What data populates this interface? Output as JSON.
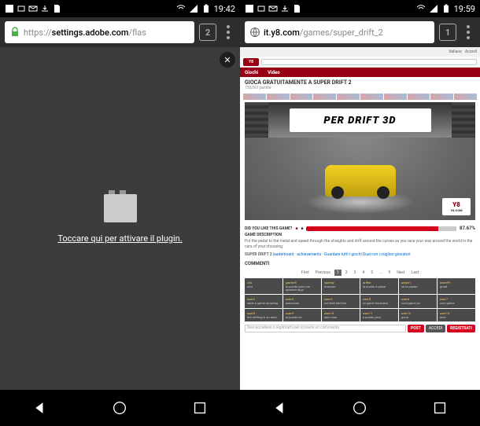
{
  "left": {
    "status": {
      "time": "19:42"
    },
    "browser": {
      "url_protocol": "https://",
      "url_domain": "settings.adobe.com",
      "url_path": "/flas",
      "tab_count": "2"
    },
    "content": {
      "plugin_text": "Toccare qui per attivare il plugin."
    }
  },
  "right": {
    "status": {
      "time": "19:59"
    },
    "browser": {
      "url_domain": "it.y8.com",
      "url_path": "/games/super_drift_2",
      "tab_count": "1"
    },
    "y8": {
      "logo": "Y8",
      "tabs": {
        "t1": "Giochi",
        "t2": "Video"
      },
      "title": "GIOCA GRATUITAMENTE A SUPER DRIFT 2",
      "subtitle": "750,061 partite",
      "game_banner": "PER DRIFT 3D",
      "game_logo": "Y8",
      "game_logo_sub": "Y8.COM",
      "like_label": "DID YOU LIKE THIS GAME?",
      "like_pct": "87.67%",
      "desc_label": "GAME DESCRIPTION",
      "desc_text": "Put the pedal to the metal and speed through the straights and drift around the curves as you race your way around the world in the cars of your choosing.",
      "series_label": "SUPER DRIFT 2",
      "series_links": "leaderboard · achievements · Guardare tutti i giochi Dual con i migliori giocatori",
      "comments_label": "COMMENTI",
      "pagination": {
        "first": "First",
        "prev": "Previous",
        "p1": "1",
        "p2": "2",
        "p3": "3",
        "p4": "4",
        "p5": "5",
        "p9": "9",
        "next": "Next",
        "last": "Last"
      },
      "comment_placeholder": "Devi accedere o registrarti per scrivere un commento",
      "btn_post": "POST",
      "btn_login": "ACCEDI",
      "btn_register": "REGISTRATI",
      "comments": [
        [
          {
            "u": "xXx",
            "t": "nice"
          },
          {
            "u": "gamer5",
            "t": "la puedo pero me aparece algo"
          },
          {
            "u": "speedy",
            "t": "bravooo"
          },
          {
            "u": "drifter",
            "t": "la puedo a ganar"
          },
          {
            "u": "player1",
            "t": "ok la puedo"
          },
          {
            "u": "racer99",
            "t": "great"
          }
        ],
        [
          {
            "u": "user2",
            "t": "what a game amazing"
          },
          {
            "u": "user3",
            "t": "awesome"
          },
          {
            "u": "user4",
            "t": "not that bad bro"
          },
          {
            "u": "user5",
            "t": "yo game hermano"
          },
          {
            "u": "user6",
            "t": "cool game yo"
          },
          {
            "u": "user7",
            "t": "cool game"
          }
        ],
        [
          {
            "u": "user8",
            "t": "the drifting is so hard"
          },
          {
            "u": "user9",
            "t": "la puedo eh"
          },
          {
            "u": "user10",
            "t": "epic man"
          },
          {
            "u": "user11",
            "t": "a puedo pero"
          },
          {
            "u": "user12",
            "t": "good"
          },
          {
            "u": "user13",
            "t": "nice"
          }
        ]
      ]
    }
  }
}
